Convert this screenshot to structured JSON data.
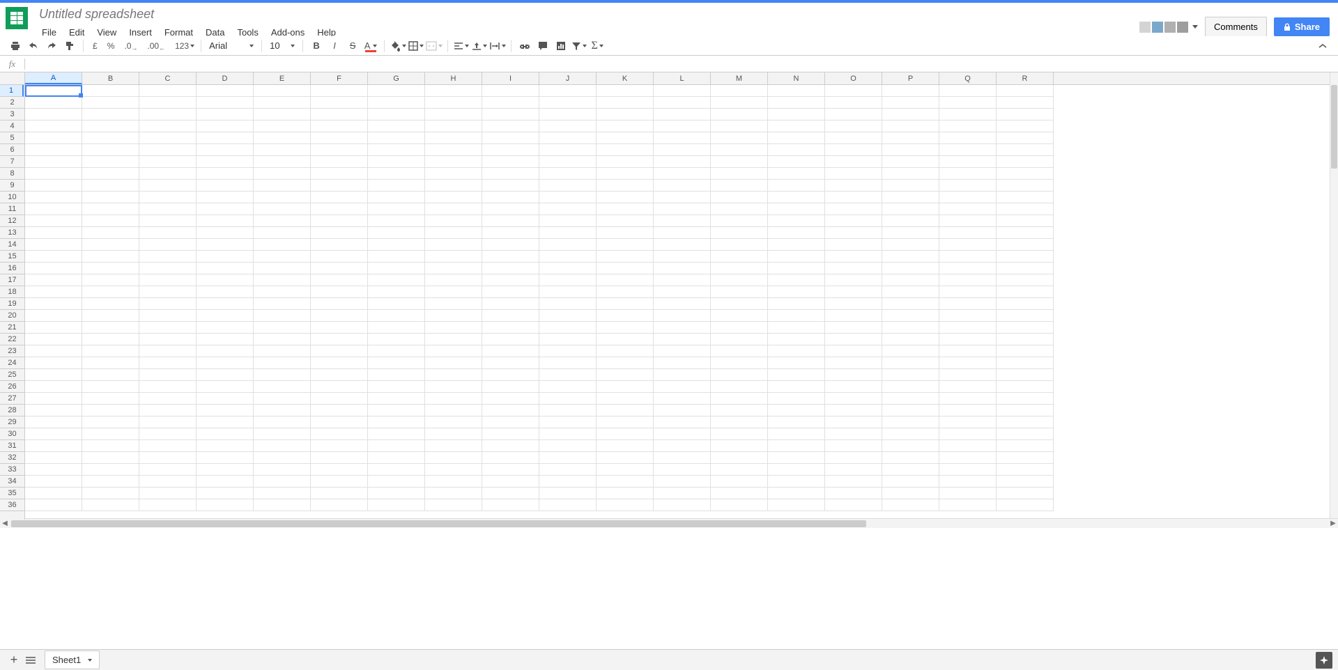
{
  "doc": {
    "title": "Untitled spreadsheet"
  },
  "menubar": {
    "items": [
      "File",
      "Edit",
      "View",
      "Insert",
      "Format",
      "Data",
      "Tools",
      "Add-ons",
      "Help"
    ]
  },
  "header_right": {
    "comments": "Comments",
    "share": "Share"
  },
  "toolbar": {
    "currency": "£",
    "percent": "%",
    "dec_less": ".0",
    "dec_more": ".00",
    "format_123": "123",
    "font": "Arial",
    "size": "10"
  },
  "formula": {
    "fx": "fx",
    "value": ""
  },
  "columns": [
    "A",
    "B",
    "C",
    "D",
    "E",
    "F",
    "G",
    "H",
    "I",
    "J",
    "K",
    "L",
    "M",
    "N",
    "O",
    "P",
    "Q",
    "R"
  ],
  "rows": [
    "1",
    "2",
    "3",
    "4",
    "5",
    "6",
    "7",
    "8",
    "9",
    "10",
    "11",
    "12",
    "13",
    "14",
    "15",
    "16",
    "17",
    "18",
    "19",
    "20",
    "21",
    "22",
    "23",
    "24",
    "25",
    "26",
    "27",
    "28",
    "29",
    "30",
    "31",
    "32",
    "33",
    "34",
    "35",
    "36"
  ],
  "selected_cell": "A1",
  "footer": {
    "sheet1": "Sheet1",
    "add": "+"
  }
}
